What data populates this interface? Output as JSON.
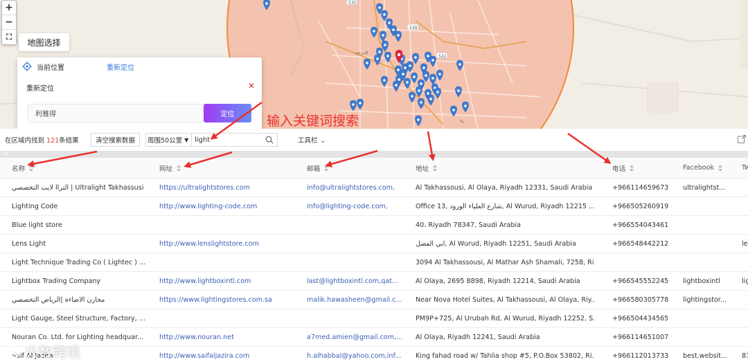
{
  "map": {
    "zoom_in": "+",
    "zoom_out": "−",
    "fullscreen": "⛶",
    "map_select_label": "地图选择",
    "current_location_label": "当前位置",
    "relocate_link": "重新定位",
    "relocate_title": "重新定位",
    "close_icon": "✕",
    "location_input_value": "利雅得",
    "locate_button": "定位",
    "road_labels": [
      "535",
      "539",
      "522",
      "رة"
    ],
    "city_label": "الدرعية"
  },
  "annotation": "输入关键词搜索",
  "toolbar": {
    "found_prefix": "在区域内找到 ",
    "found_count": "121",
    "found_suffix": "条结果",
    "clear_button": "清空搜索数据",
    "radius_select": "周围50公里",
    "search_value": "light",
    "tools_label": "工具栏"
  },
  "progress": {
    "label": "0%",
    "value": 0
  },
  "table": {
    "headers": [
      "名称",
      "网址",
      "邮箱",
      "地址",
      "电话",
      "Facebook",
      "Tw"
    ],
    "rows": [
      [
        "التراا لايت التخصصي | Ultralight Takhassusi",
        "https://ultralightstores.com",
        "info@ultralightstores.com,",
        "Al Takhassousi, Al Olaya, Riyadh 12331, Saudi Arabia",
        "+966114659673",
        "ultralightst...",
        ""
      ],
      [
        "Lighting Code",
        "http://www.lighting-code.com",
        "info@lighting-code.com,",
        "Office 13, شارع العلياء الورود, Al Wurud, Riyadh 12215 ...",
        "+966505260919",
        "",
        ""
      ],
      [
        "Blue light store",
        "",
        "",
        "40، Riyadh 78347, Saudi Arabia",
        "+966554043461",
        "",
        ""
      ],
      [
        "Lens Light",
        "http://www.lenslightstore.com",
        "",
        "ابي الفضل, Al Wurud, Riyadh 12251, Saudi Arabia",
        "+966548442212",
        "",
        "le"
      ],
      [
        "Light Technique Trading Co ( Lightec ) ...",
        "",
        "",
        "3094 Al Takhassousi, Al Mathar Ash Shamali, 7258, Ri...",
        "",
        "",
        ""
      ],
      [
        "Lightbox Trading Company",
        "http://www.lightboxintl.com",
        "last@lightboxintl.com,qat...",
        "Al Olaya, 2695 8898, Riyadh 12214, Saudi Arabia",
        "+966545552245",
        "lightboxintl",
        "lig"
      ],
      [
        "مخارن الاضاءة |الرياض التخصصي",
        "https://www.lightingstores.com.sa",
        "malik.hawasheen@gmail.c...",
        "Near Nova Hotel Suites, Al Takhassousi, Al Olaya, Riy...",
        "+966580305778",
        "lightingstor...",
        ""
      ],
      [
        "Light Gauge, Steel Structure, Factory, ...",
        "",
        "",
        "PM9P+725, Al Urubah Rd, Al Wurud, Riyadh 12252, S...",
        "+966504434565",
        "",
        ""
      ],
      [
        "Nouran Co. Ltd. for Lighting headquar...",
        "http://www.nouran.net",
        "a7med.amien@gmail.com,...",
        "Al Olaya, Riyadh 12241, Saudi Arabia",
        "+966114651007",
        "",
        ""
      ],
      [
        "Saif Al Jazira",
        "http://www.saifaljazira.com",
        "h.alhabbal@yahoo.com,inf...",
        "King fahad road w/ Tahlia shop #5, P.O.Box 53802, Ri...",
        "+966112013733",
        "best.websit...",
        "87"
      ]
    ]
  },
  "watermark": "大数跨境",
  "colors": {
    "accent_blue": "#3b7dd8",
    "link": "#3b5fb5",
    "annotation_red": "#e8312e",
    "count_red": "#e23b3b",
    "circle_fill": "#f4b49c",
    "circle_stroke": "#f08a3c",
    "marker_blue": "#3d7cd6",
    "marker_red": "#d9243c"
  }
}
